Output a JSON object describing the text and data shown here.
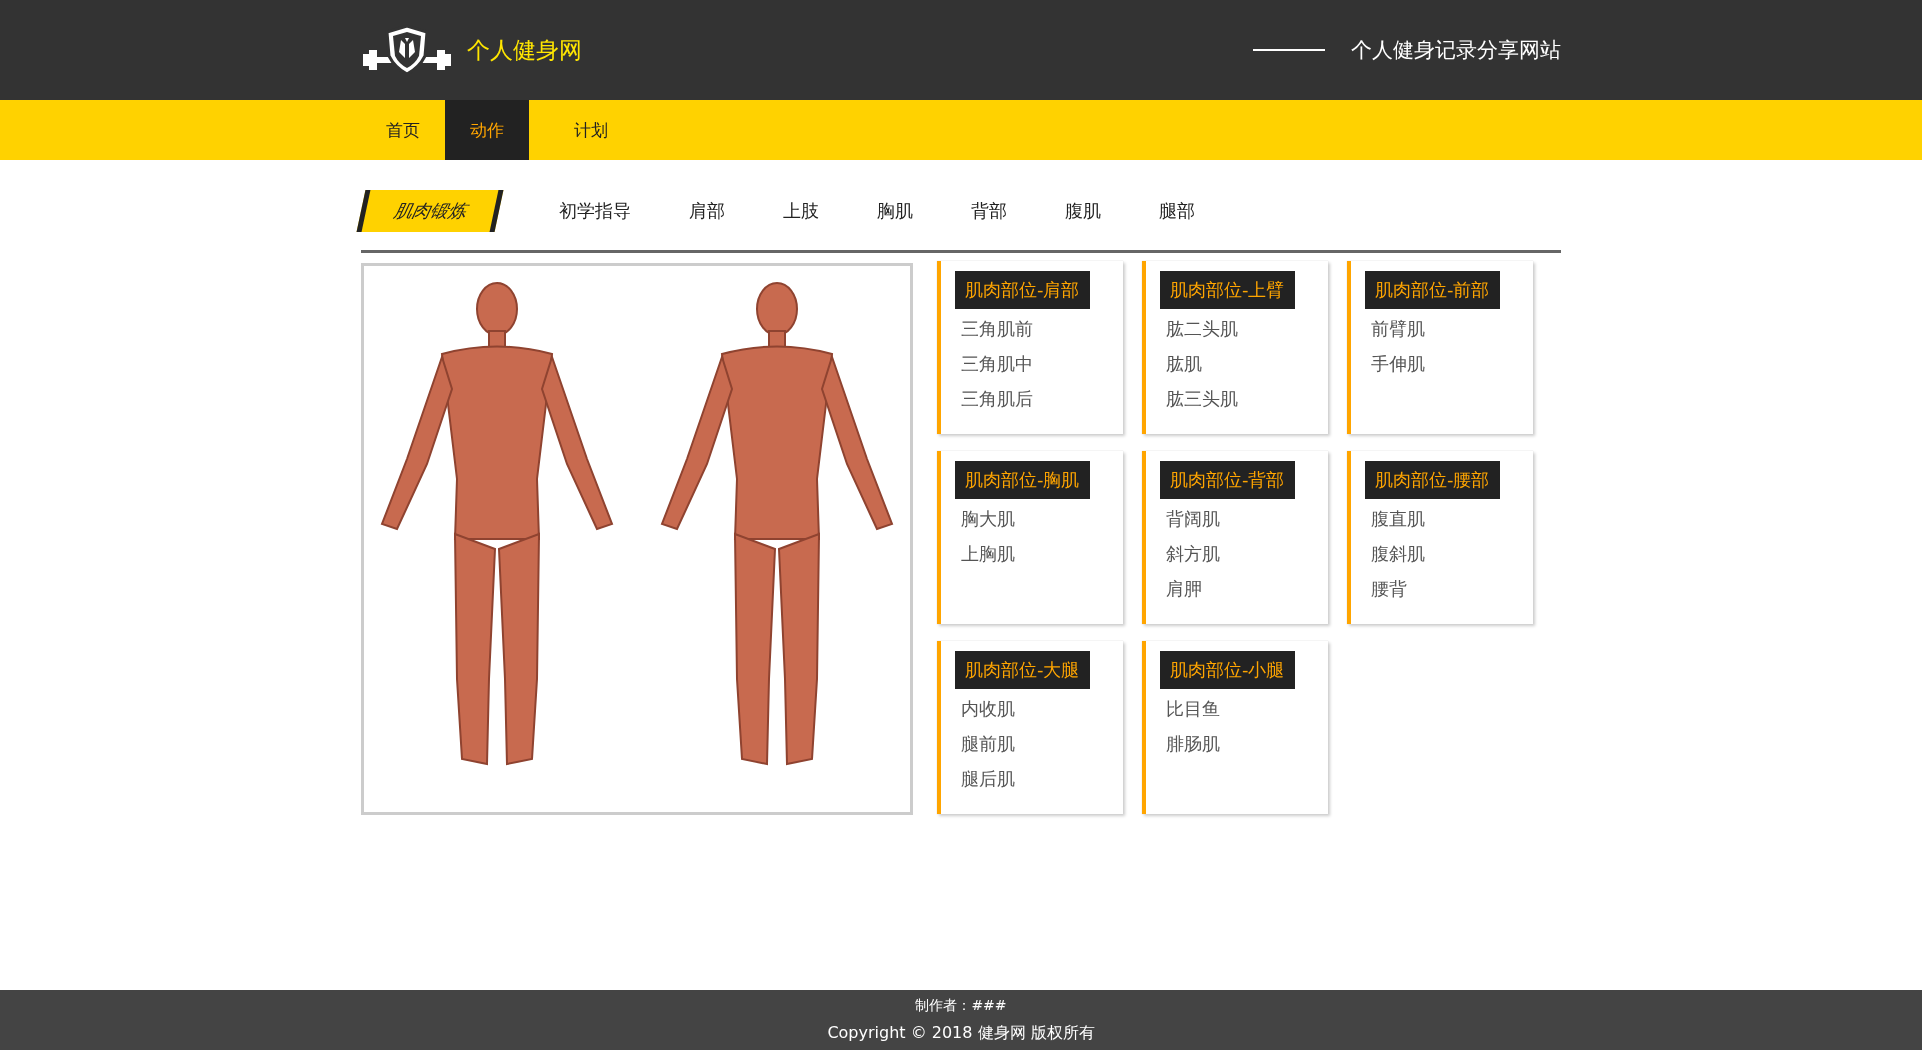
{
  "header": {
    "site_name": "个人健身网",
    "tagline": "个人健身记录分享网站"
  },
  "nav": [
    {
      "label": "首页",
      "selected": false
    },
    {
      "label": "动作",
      "selected": true
    },
    {
      "label": "计划",
      "selected": false
    }
  ],
  "section": {
    "title": "肌肉锻炼",
    "links": [
      "初学指导",
      "肩部",
      "上肢",
      "胸肌",
      "背部",
      "腹肌",
      "腿部"
    ]
  },
  "muscle_groups": [
    {
      "title": "肌肉部位-肩部",
      "items": [
        "三角肌前",
        "三角肌中",
        "三角肌后"
      ]
    },
    {
      "title": "肌肉部位-上臂",
      "items": [
        "肱二头肌",
        "肱肌",
        "肱三头肌"
      ]
    },
    {
      "title": "肌肉部位-前部",
      "items": [
        "前臂肌",
        "手伸肌"
      ]
    },
    {
      "title": "肌肉部位-胸肌",
      "items": [
        "胸大肌",
        "上胸肌"
      ]
    },
    {
      "title": "肌肉部位-背部",
      "items": [
        "背阔肌",
        "斜方肌",
        "肩胛"
      ]
    },
    {
      "title": "肌肉部位-腰部",
      "items": [
        "腹直肌",
        "腹斜肌",
        "腰背"
      ]
    },
    {
      "title": "肌肉部位-大腿",
      "items": [
        "内收肌",
        "腿前肌",
        "腿后肌"
      ]
    },
    {
      "title": "肌肉部位-小腿",
      "items": [
        "比目鱼",
        "腓肠肌"
      ]
    }
  ],
  "footer": {
    "author": "制作者：###",
    "copyright": "Copyright © 2018 健身网 版权所有"
  }
}
